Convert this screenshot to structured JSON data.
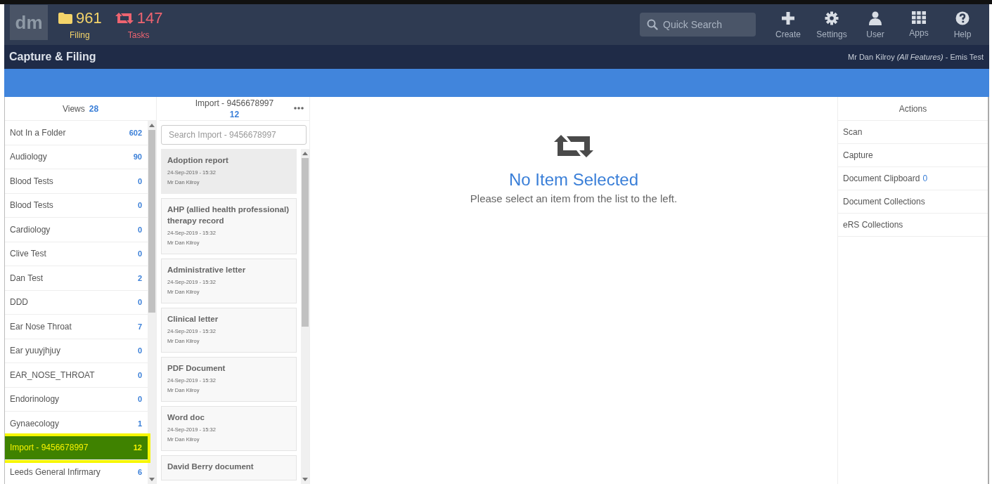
{
  "header": {
    "logo": "dm",
    "counters": [
      {
        "kind": "filing",
        "value": "961",
        "label": "Filing"
      },
      {
        "kind": "tasks",
        "value": "147",
        "label": "Tasks"
      }
    ],
    "search": {
      "placeholder": "Quick Search"
    },
    "nav": [
      {
        "kind": "create",
        "label": "Create"
      },
      {
        "kind": "settings",
        "label": "Settings"
      },
      {
        "kind": "user",
        "label": "User"
      },
      {
        "kind": "apps",
        "label": "Apps"
      },
      {
        "kind": "help",
        "label": "Help"
      }
    ]
  },
  "subheader": {
    "title": "Capture & Filing",
    "user": "Mr Dan Kilroy *(All Features)* - Emis Test"
  },
  "views": {
    "title": "Views",
    "count": "28",
    "items": [
      {
        "name": "Not In a Folder",
        "count": "602",
        "selected": false
      },
      {
        "name": "Audiology",
        "count": "90",
        "selected": false
      },
      {
        "name": "Blood Tests",
        "count": "0",
        "selected": false
      },
      {
        "name": "Blood Tests",
        "count": "0",
        "selected": false
      },
      {
        "name": "Cardiology",
        "count": "0",
        "selected": false
      },
      {
        "name": "Clive Test",
        "count": "0",
        "selected": false
      },
      {
        "name": "Dan Test",
        "count": "2",
        "selected": false
      },
      {
        "name": "DDD",
        "count": "0",
        "selected": false
      },
      {
        "name": "Ear Nose Throat",
        "count": "7",
        "selected": false
      },
      {
        "name": "Ear yuuyjhjuy",
        "count": "0",
        "selected": false
      },
      {
        "name": "EAR_NOSE_THROAT",
        "count": "0",
        "selected": false
      },
      {
        "name": "Endorinology",
        "count": "0",
        "selected": false
      },
      {
        "name": "Gynaecology",
        "count": "1",
        "selected": false
      },
      {
        "name": "Import - 9456678997",
        "count": "12",
        "selected": true
      },
      {
        "name": "Leeds General Infirmary",
        "count": "6",
        "selected": false
      }
    ]
  },
  "list": {
    "title": "Import - 9456678997",
    "count": "12",
    "search": {
      "placeholder": "Search Import - 9456678997"
    },
    "items": [
      {
        "title": "Adoption report",
        "date": "24-Sep-2019 - 15:32",
        "author": "Mr Dan Kilroy",
        "selected": true
      },
      {
        "title": "AHP (allied health professional) therapy record",
        "date": "24-Sep-2019 - 15:32",
        "author": "Mr Dan Kilroy",
        "selected": false
      },
      {
        "title": "Administrative letter",
        "date": "24-Sep-2019 - 15:32",
        "author": "Mr Dan Kilroy",
        "selected": false
      },
      {
        "title": "Clinical letter",
        "date": "24-Sep-2019 - 15:32",
        "author": "Mr Dan Kilroy",
        "selected": false
      },
      {
        "title": "PDF Document",
        "date": "24-Sep-2019 - 15:32",
        "author": "Mr Dan Kilroy",
        "selected": false
      },
      {
        "title": "Word doc",
        "date": "24-Sep-2019 - 15:32",
        "author": "Mr Dan Kilroy",
        "selected": false
      },
      {
        "title": "David Berry document",
        "selected": false
      }
    ]
  },
  "main": {
    "heading": "No Item Selected",
    "message": "Please select an item from the list to the left."
  },
  "actions": {
    "title": "Actions",
    "items": [
      {
        "label": "Scan"
      },
      {
        "label": "Capture"
      },
      {
        "label": "Document Clipboard",
        "count": "0"
      },
      {
        "label": "Document Collections"
      },
      {
        "label": "eRS Collections"
      }
    ]
  }
}
